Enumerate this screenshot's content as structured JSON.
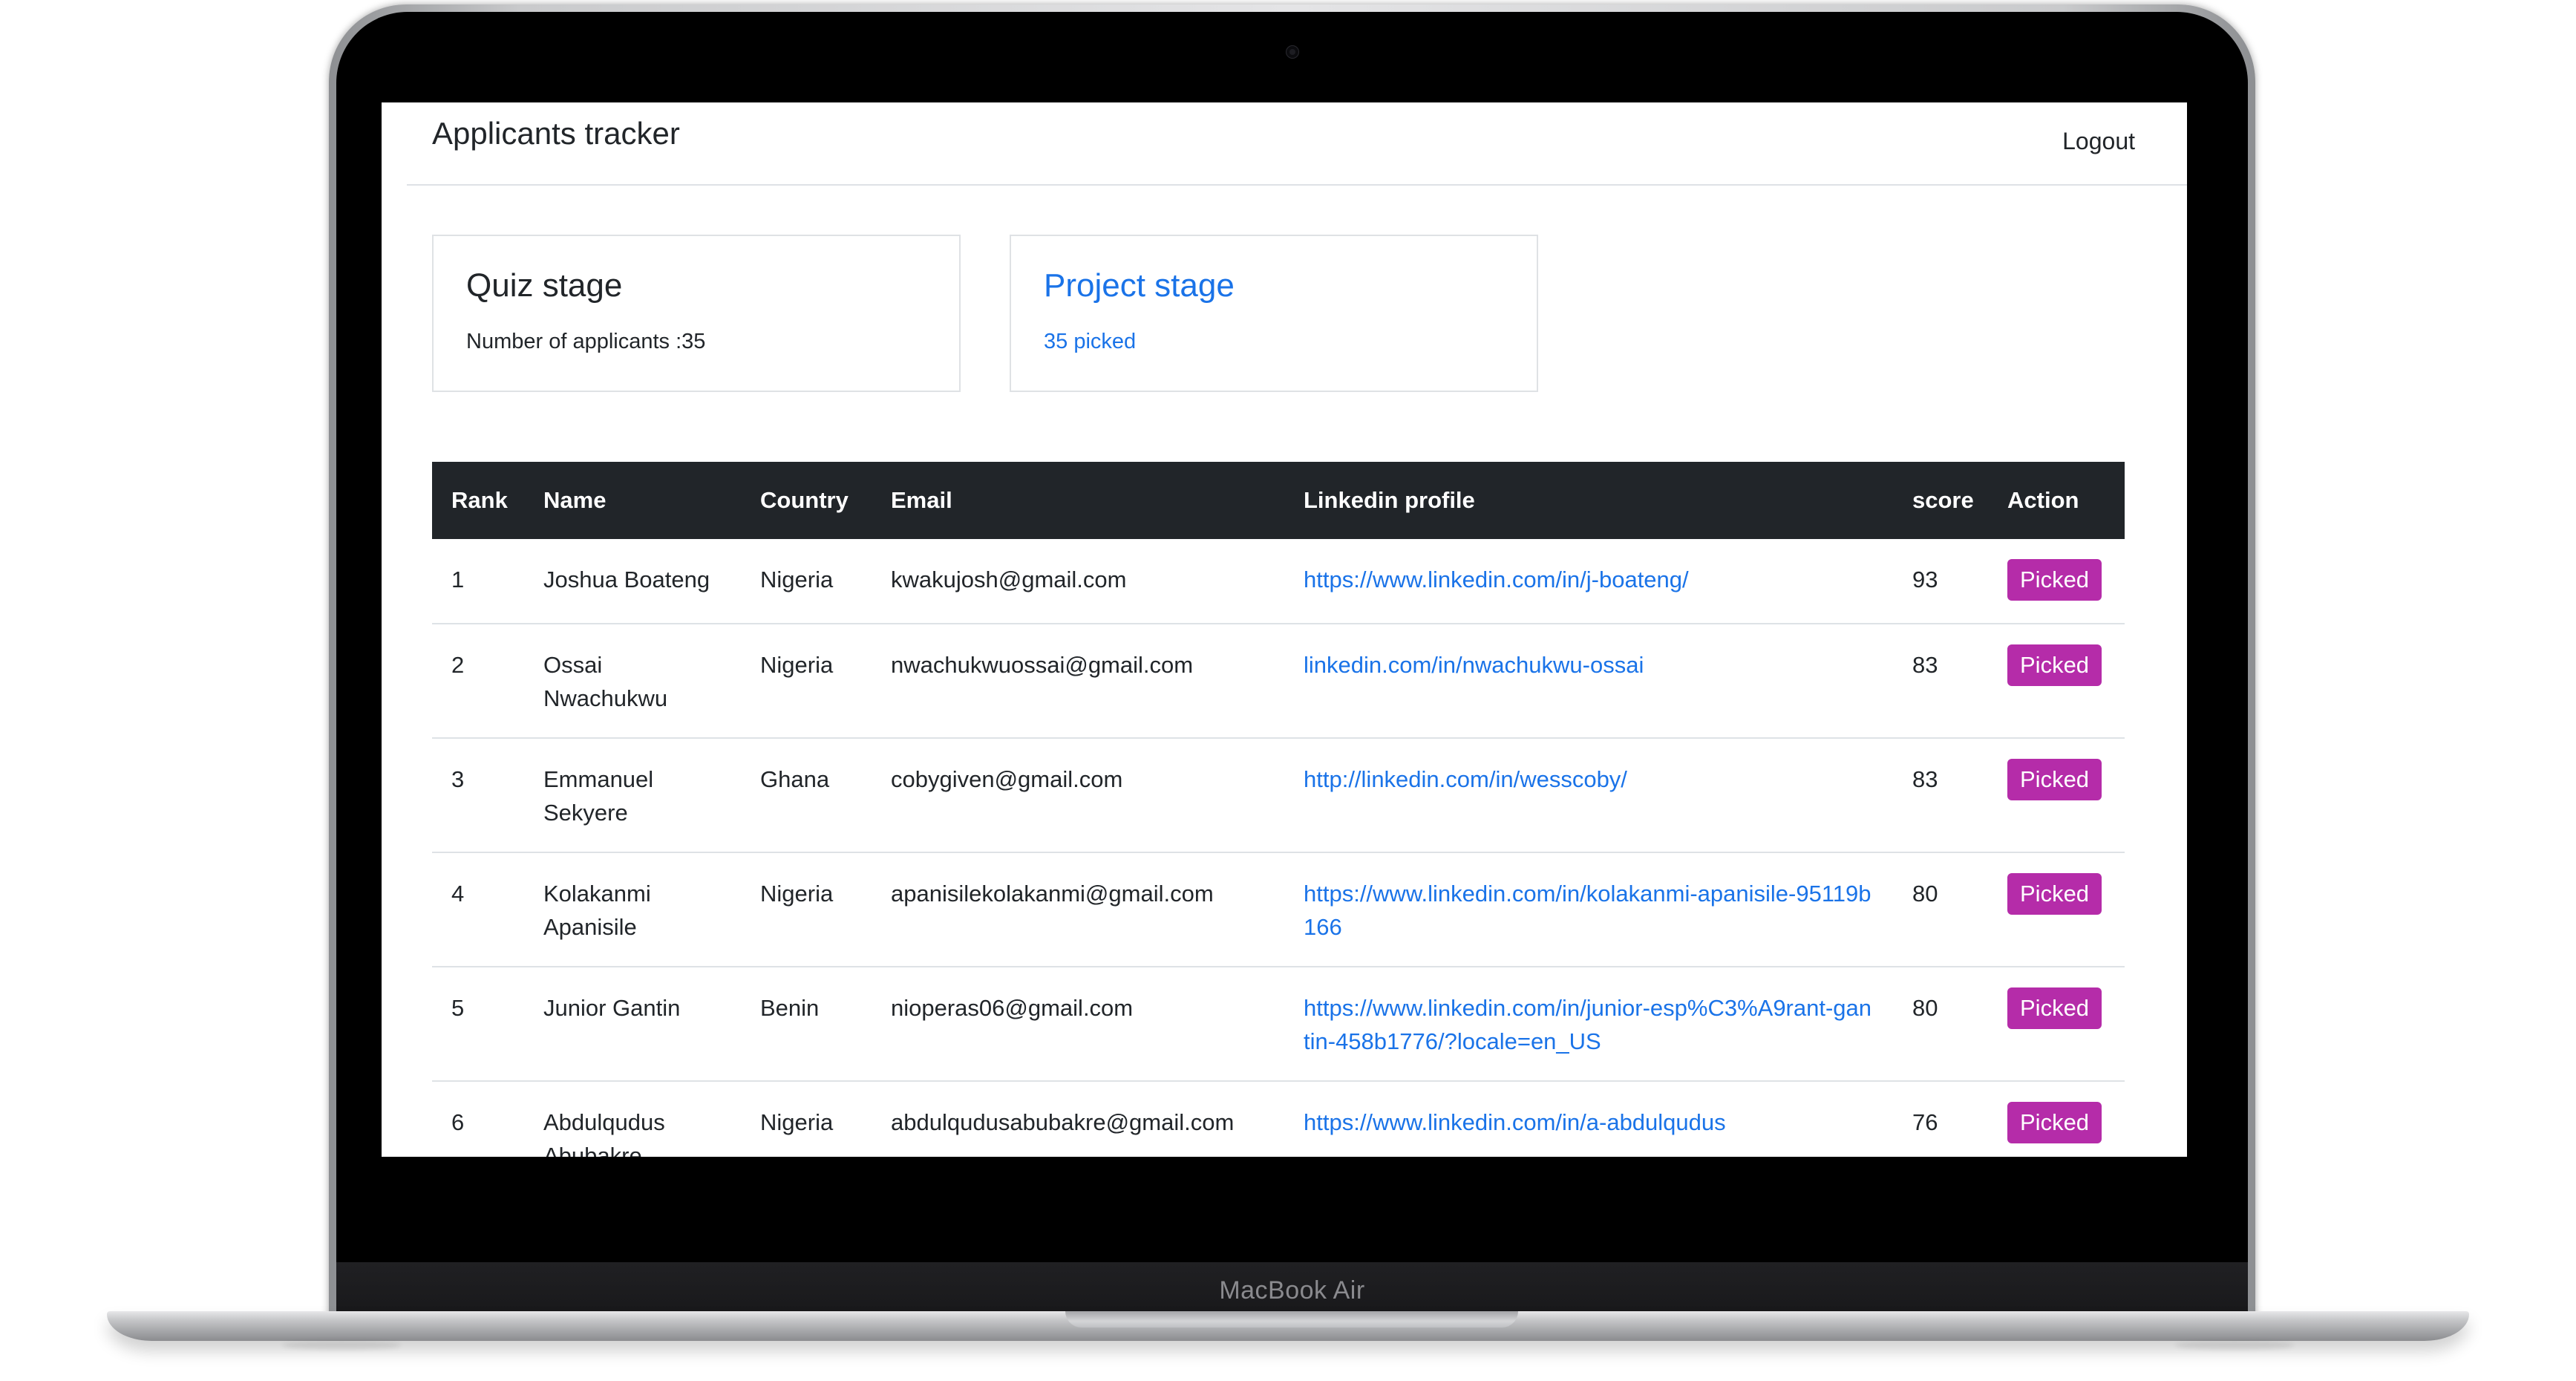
{
  "app": {
    "title": "Applicants tracker",
    "logout_label": "Logout"
  },
  "device": {
    "label": "MacBook Air"
  },
  "cards": [
    {
      "title": "Quiz stage",
      "text": "Number of applicants :35"
    },
    {
      "title": "Project stage",
      "text": "35 picked"
    }
  ],
  "table": {
    "columns": [
      "Rank",
      "Name",
      "Country",
      "Email",
      "Linkedin profile",
      "score",
      "Action"
    ],
    "rows": [
      {
        "rank": "1",
        "name": "Joshua Boateng",
        "country": "Nigeria",
        "email": "kwakujosh@gmail.com",
        "linkedin": "https://www.linkedin.com/in/j-boateng/",
        "score": "93",
        "action": "Picked"
      },
      {
        "rank": "2",
        "name": "Ossai Nwachukwu",
        "country": "Nigeria",
        "email": "nwachukwuossai@gmail.com",
        "linkedin": "linkedin.com/in/nwachukwu-ossai",
        "score": "83",
        "action": "Picked"
      },
      {
        "rank": "3",
        "name": "Emmanuel Sekyere",
        "country": "Ghana",
        "email": "cobygiven@gmail.com",
        "linkedin": "http://linkedin.com/in/wesscoby/",
        "score": "83",
        "action": "Picked"
      },
      {
        "rank": "4",
        "name": "Kolakanmi Apanisile",
        "country": "Nigeria",
        "email": "apanisilekolakanmi@gmail.com",
        "linkedin": "https://www.linkedin.com/in/kolakanmi-apanisile-95119b166",
        "score": "80",
        "action": "Picked"
      },
      {
        "rank": "5",
        "name": "Junior Gantin",
        "country": "Benin",
        "email": "nioperas06@gmail.com",
        "linkedin": "https://www.linkedin.com/in/junior-esp%C3%A9rant-gantin-458b1776/?locale=en_US",
        "score": "80",
        "action": "Picked"
      },
      {
        "rank": "6",
        "name": "Abdulqudus Abubakre",
        "country": "Nigeria",
        "email": "abdulqudusabubakre@gmail.com",
        "linkedin": "https://www.linkedin.com/in/a-abdulqudus",
        "score": "76",
        "action": "Picked"
      }
    ]
  },
  "colors": {
    "link": "#1a73e8",
    "table_header_bg": "#212529",
    "picked_button": "#b52ca9"
  }
}
